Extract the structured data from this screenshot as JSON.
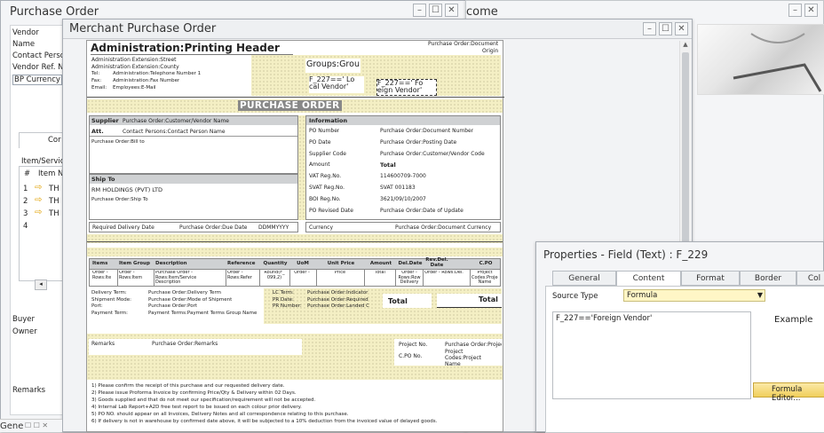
{
  "purchase_order_window": {
    "title": "Purchase Order",
    "fields": [
      "Vendor",
      "Name",
      "Contact Perso",
      "Vendor Ref. N",
      "BP Currency"
    ],
    "tab": "Cor",
    "table_header": "Item/Servic",
    "table_cols": [
      "#",
      "Item N"
    ],
    "rows": [
      "1",
      "2",
      "3",
      "4"
    ],
    "row_text": "TH",
    "lower_fields": [
      "Buyer",
      "Owner"
    ],
    "remarks": "Remarks"
  },
  "welcome_window": {
    "title": "come"
  },
  "merchant_window": {
    "title": "Merchant Purchase Order"
  },
  "doc": {
    "header_title": "Administration:Printing Header",
    "address_lines": [
      "Administration Extension:Street",
      "Administration Extension:County"
    ],
    "tel_label": "Tel:",
    "tel_value": "Administration:Telephone Number 1",
    "fax_label": "Fax:",
    "fax_value": "Administration:Fax Number",
    "email_label": "Email:",
    "email_value": "Employees:E-Mail",
    "doc_origin": "Purchase Order:Document",
    "doc_origin2": "Origin",
    "group_label": "Groups:Grou",
    "f227_text": "F_227==' Lo",
    "f227_text2": "cal Vendor'",
    "f229_text": "F_227==' Fo",
    "f229_text2": "eign Vendor'",
    "po_title": "PURCHASE ORDER",
    "supplier_label": "Supplier",
    "supplier_value": "Purchase Order:Customer/Vendor Name",
    "attn_label": "Att.",
    "attn_value": "Contact Persons:Contact Person Name",
    "bill_to": "Purchase Order:Bill to",
    "ship_to_label": "Ship To",
    "ship_company": "RM HOLDINGS (PVT) LTD",
    "ship_to_value": "Purchase Order:Ship To",
    "info_label": "Information",
    "info_rows": [
      {
        "k": "PO Number",
        "v": "Purchase Order:Document Number"
      },
      {
        "k": "PO Date",
        "v": "Purchase Order:Posting Date"
      },
      {
        "k": "Supplier Code",
        "v": "Purchase Order:Customer/Vendor Code"
      },
      {
        "k": "Amount",
        "v": "Total"
      },
      {
        "k": "VAT Reg.No.",
        "v": "114600709-7000"
      },
      {
        "k": "SVAT Reg.No.",
        "v": "SVAT 001183"
      },
      {
        "k": "BOI Reg.No.",
        "v": "3621/09/10/2007"
      },
      {
        "k": "PO Revised Date",
        "v": "Purchase Order:Date of Update"
      }
    ],
    "req_delivery_label": "Required Delivery Date",
    "req_delivery_value": "Purchase Order:Due Date",
    "date_format": "DDMMYYYY",
    "currency_label": "Currency",
    "currency_value": "Purchase Order:Document Currency",
    "item_cols": [
      "Items",
      "Item Group",
      "Description",
      "Reference",
      "Quantity",
      "UoM",
      "Unit Price",
      "Amount",
      "Del.Date",
      "Rev.Del. Date",
      "C.PO"
    ],
    "item_row": [
      "Order - Rows:Ite",
      "Order - Rows:Item",
      "Purchase Order - Rows:Item/Service Description",
      "Order - Rows:Refer",
      "Round(F_ 099,2)",
      "Order -",
      "Price",
      "Total",
      "Order - Rows:Row Delivery",
      "Order - Rows:Del.",
      "Project Codes:Project Name"
    ],
    "terms": [
      {
        "k": "Delivery Term:",
        "v": "Purchase Order:Delivery Term"
      },
      {
        "k": "Shipment Mode:",
        "v": "Purchase Order:Mode of Shipment"
      },
      {
        "k": "Port:",
        "v": "Purchase Order:Port"
      },
      {
        "k": "Payment Term:",
        "v": "Payment Terms:Payment Terms Group Name"
      }
    ],
    "lc_terms": [
      {
        "k": "LC Term:",
        "v": "Purchase Order:Indicator"
      },
      {
        "k": "PR Date:",
        "v": "Purchase Order:Required"
      },
      {
        "k": "PR Number:",
        "v": "Purchase Order:Landed C"
      }
    ],
    "total_label": "Total",
    "total_label2": "Total",
    "remarks_label": "Remarks",
    "remarks_value": "Purchase Order:Remarks",
    "project_no_label": "Project No.",
    "project_no_value": "Purchase Order:Projec",
    "cpo_label": "C.PO No.",
    "cpo_value": "Project Codes:Project Name",
    "notes": [
      "1) Please confirm the receipt of this purchase and our requested delivery date.",
      "2) Please issue Proforma Invoice by confirming Price/Qty & Delivery within 02 Days.",
      "3) Goods supplied and that do not meet our specification/requirement will not be accepted.",
      "4) Internal Lab Report+A2D free test report to be issued on each colour prior delivery.",
      "5) PO NO. should appear on all Invoices, Delivery Notes and all correspondence relating to this purchase.",
      "6) If delivery is not in warehouse by confirmed date above, it will be subjected to a 10% deduction from the invoiced value of delayed goods."
    ]
  },
  "properties": {
    "title": "Properties - Field (Text) : F_229",
    "tabs": [
      "General",
      "Content",
      "Format",
      "Border",
      "Col"
    ],
    "source_type_label": "Source Type",
    "source_type_value": "Formula",
    "formula": "F_227=='Foreign Vendor'",
    "example_label": "Example",
    "formula_editor": "Formula Editor..."
  },
  "bottom_left": {
    "label": "Gene"
  }
}
